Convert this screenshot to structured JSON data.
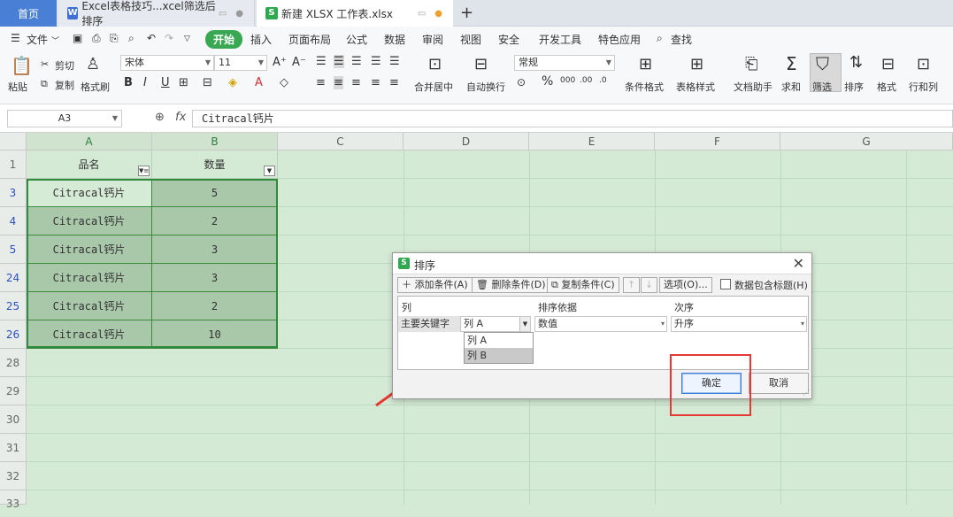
{
  "tabs": {
    "home": "首页",
    "doc1": "Excel表格技巧...xcel筛选后排序",
    "doc2": "新建 XLSX 工作表.xlsx",
    "add": "+"
  },
  "menu": {
    "file": "文件",
    "start": "开始",
    "items": [
      "插入",
      "页面布局",
      "公式",
      "数据",
      "审阅",
      "视图",
      "安全",
      "开发工具",
      "特色应用"
    ],
    "search": "查找"
  },
  "ribbon": {
    "paste": "粘贴",
    "cut": "剪切",
    "copy": "复制",
    "format_painter": "格式刷",
    "font": "宋体",
    "size": "11",
    "merge": "合并居中",
    "wrap": "自动换行",
    "number_format": "常规",
    "cond_format": "条件格式",
    "table_style": "表格样式",
    "doc_helper": "文档助手",
    "sum": "求和",
    "filter": "筛选",
    "sort": "排序",
    "format": "格式",
    "rowcol": "行和列"
  },
  "formula": {
    "cell_ref": "A3",
    "fx": "fx",
    "content": "Citracal钙片"
  },
  "columns": [
    "A",
    "B",
    "C",
    "D",
    "E",
    "F",
    "G"
  ],
  "header_row": {
    "row": "1",
    "a": "品名",
    "b": "数量"
  },
  "rows": [
    {
      "row": "3",
      "a": "Citracal钙片",
      "b": "5"
    },
    {
      "row": "4",
      "a": "Citracal钙片",
      "b": "2"
    },
    {
      "row": "5",
      "a": "Citracal钙片",
      "b": "3"
    },
    {
      "row": "24",
      "a": "Citracal钙片",
      "b": "3"
    },
    {
      "row": "25",
      "a": "Citracal钙片",
      "b": "2"
    },
    {
      "row": "26",
      "a": "Citracal钙片",
      "b": "10"
    }
  ],
  "empty_rows": [
    "28",
    "29",
    "30",
    "31",
    "32",
    "33"
  ],
  "dialog": {
    "title": "排序",
    "add_condition": "添加条件(A)",
    "delete_condition": "删除条件(D)",
    "copy_condition": "复制条件(C)",
    "options": "选项(O)...",
    "has_header": "数据包含标题(H)",
    "col_header": "列",
    "sort_on_header": "排序依据",
    "order_header": "次序",
    "primary_key": "主要关键字",
    "column_value": "列 A",
    "sort_on_value": "数值",
    "order_value": "升序",
    "dropdown_options": [
      "列 A",
      "列 B"
    ],
    "ok": "确定",
    "cancel": "取消"
  },
  "colors": {
    "accent_green": "#3aa852",
    "sheet_bg": "#d4ead4",
    "annotation_red": "#e53935"
  }
}
